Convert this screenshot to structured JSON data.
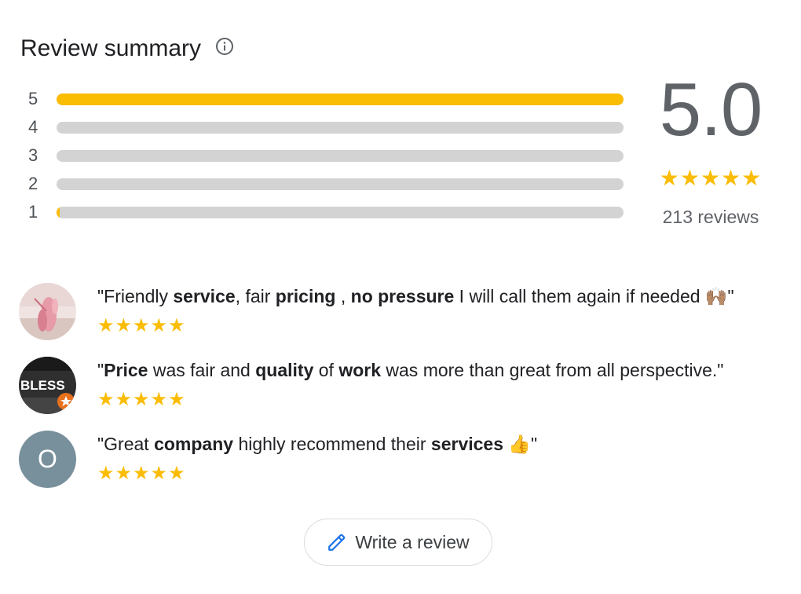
{
  "header": {
    "title": "Review summary",
    "info_icon": "info-icon"
  },
  "rating_bars": [
    {
      "label": "5",
      "fill_fraction": 1.0
    },
    {
      "label": "4",
      "fill_fraction": 0.0
    },
    {
      "label": "3",
      "fill_fraction": 0.0
    },
    {
      "label": "2",
      "fill_fraction": 0.0
    },
    {
      "label": "1",
      "fill_fraction": 0.005
    }
  ],
  "summary": {
    "score": "5.0",
    "stars": "★★★★★",
    "stars_value": 5,
    "review_count": "213 reviews"
  },
  "reviews": [
    {
      "stars": "★★★★★",
      "rating": 5,
      "avatar_initial": "",
      "segments": [
        {
          "t": "\"Friendly ",
          "b": false
        },
        {
          "t": "service",
          "b": true
        },
        {
          "t": ", fair ",
          "b": false
        },
        {
          "t": "pricing",
          "b": true
        },
        {
          "t": " , ",
          "b": false
        },
        {
          "t": "no pressure",
          "b": true
        },
        {
          "t": " I will call them again if needed 🙌🏽\"",
          "b": false
        }
      ]
    },
    {
      "stars": "★★★★★",
      "rating": 5,
      "avatar_initial": "BLESS",
      "segments": [
        {
          "t": "\"",
          "b": false
        },
        {
          "t": "Price",
          "b": true
        },
        {
          "t": " was fair and ",
          "b": false
        },
        {
          "t": "quality",
          "b": true
        },
        {
          "t": " of ",
          "b": false
        },
        {
          "t": "work",
          "b": true
        },
        {
          "t": " was more than great from all perspective.\"",
          "b": false
        }
      ]
    },
    {
      "stars": "★★★★★",
      "rating": 5,
      "avatar_initial": "O",
      "segments": [
        {
          "t": "\"Great ",
          "b": false
        },
        {
          "t": "company",
          "b": true
        },
        {
          "t": " highly recommend their ",
          "b": false
        },
        {
          "t": "services",
          "b": true
        },
        {
          "t": " 👍\"",
          "b": false
        }
      ]
    }
  ],
  "write_review": {
    "label": "Write a review",
    "icon": "pencil-icon"
  },
  "colors": {
    "star": "#fbbc04",
    "bar_track": "#d3d3d3",
    "avatar_o_bg": "#78909c"
  }
}
